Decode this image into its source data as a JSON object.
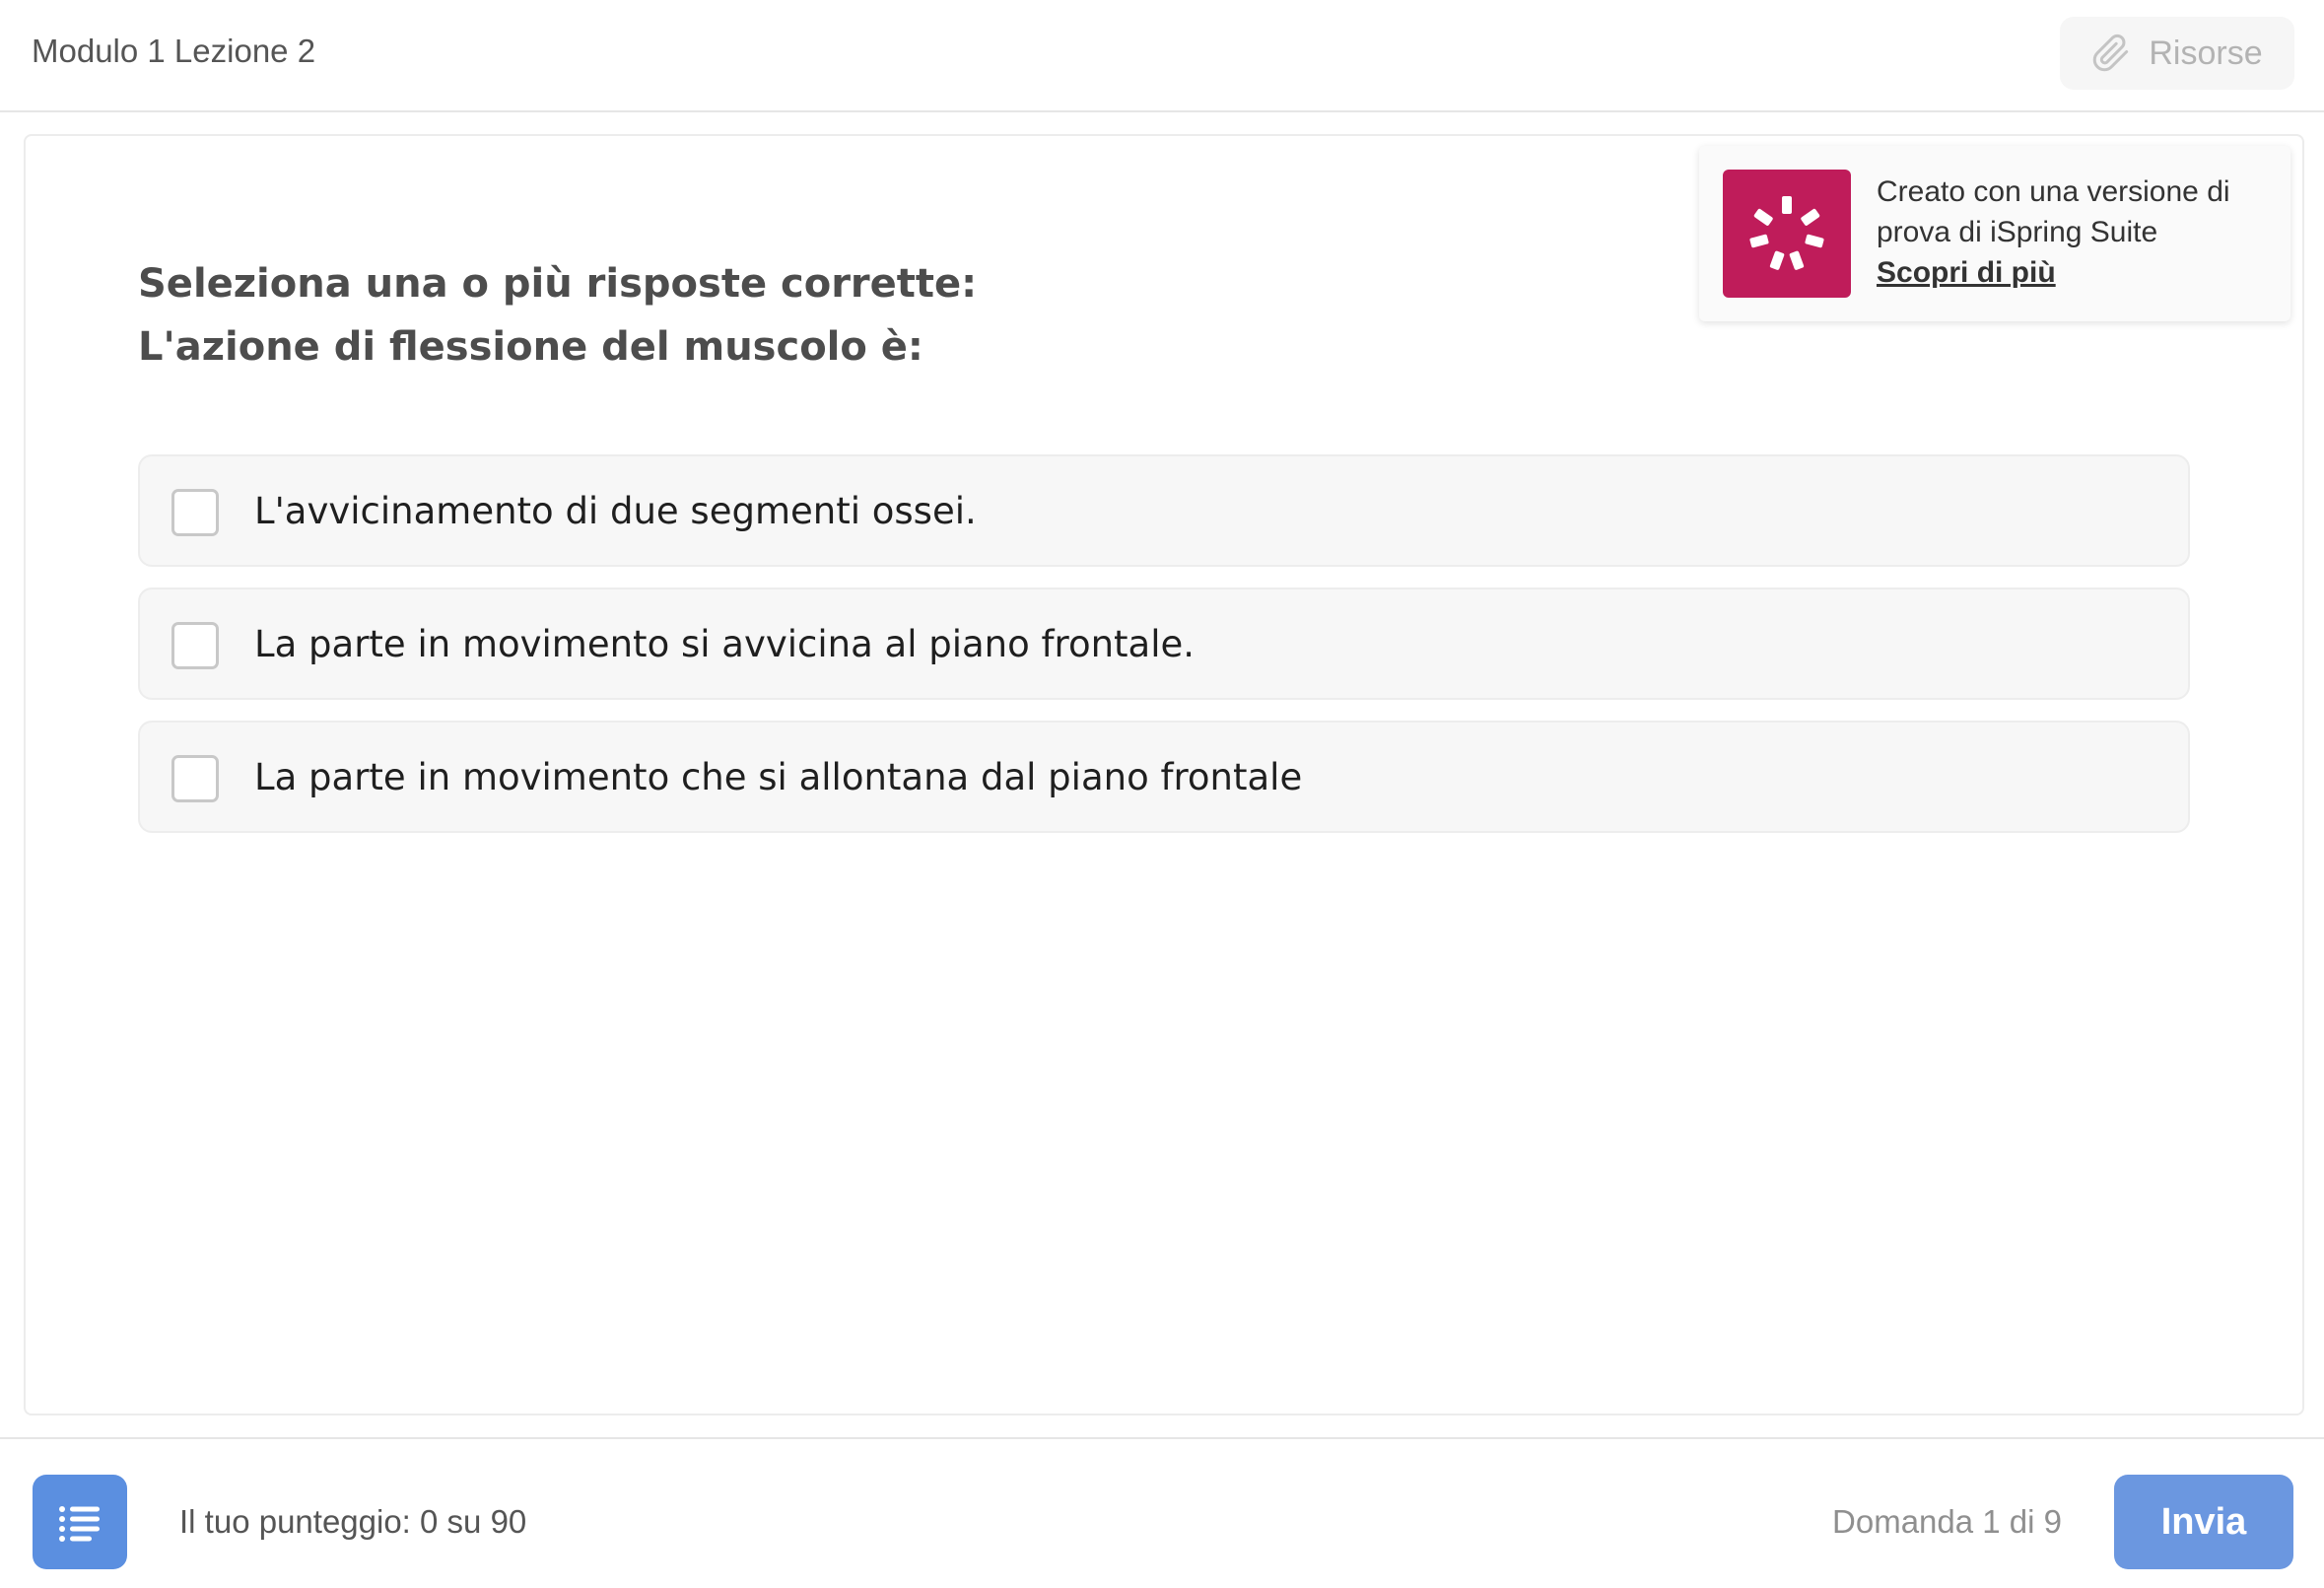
{
  "header": {
    "title": "Modulo 1 Lezione 2",
    "resources_label": "Risorse",
    "resources_icon": "paperclip-icon"
  },
  "trial_banner": {
    "line1": "Creato con una versione di prova di iSpring Suite",
    "link_label": "Scopri di più",
    "logo_icon": "ispring-logo-icon",
    "logo_color": "#bf1c5a"
  },
  "question": {
    "instruction": "Seleziona una o più risposte corrette:",
    "text": "L'azione di flessione del muscolo è:",
    "answers": [
      {
        "label": "L'avvicinamento di due segmenti ossei.",
        "checked": false
      },
      {
        "label": "La parte in movimento si avvicina al piano frontale.",
        "checked": false
      },
      {
        "label": "La parte in movimento che si allontana dal piano frontale",
        "checked": false
      }
    ]
  },
  "footer": {
    "outline_icon": "list-icon",
    "score_label": "Il tuo punteggio: 0 su 90",
    "question_counter": "Domanda 1 di 9",
    "submit_label": "Invia",
    "accent_color": "#6b97e0"
  }
}
